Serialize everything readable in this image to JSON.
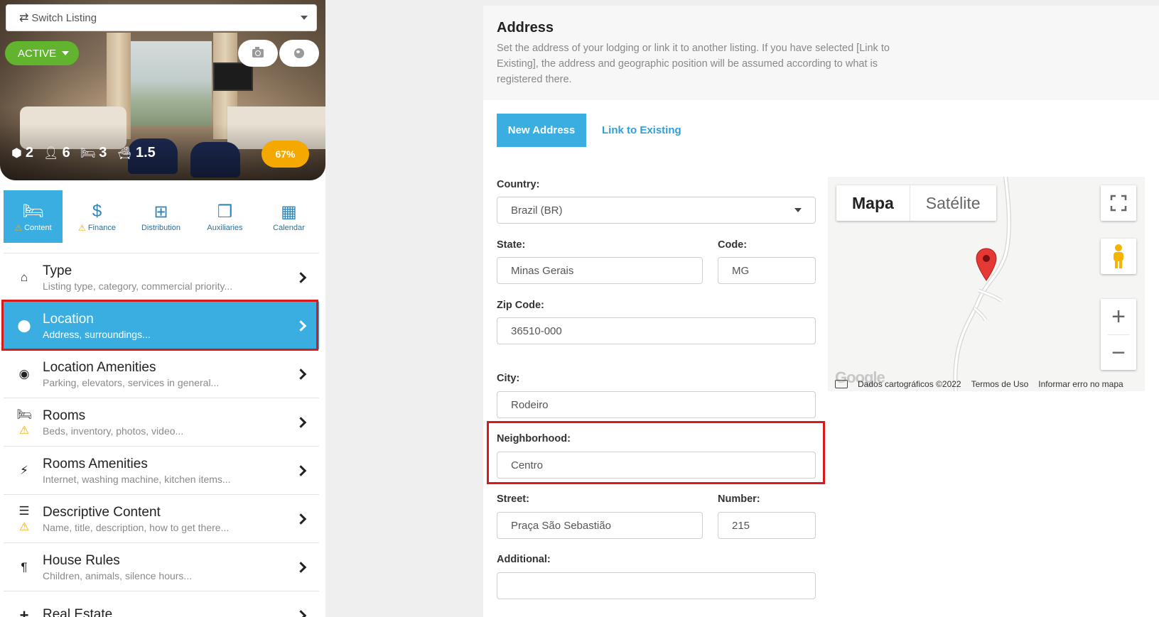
{
  "listing": {
    "switch_label": "Switch Listing",
    "status": "ACTIVE",
    "stats": {
      "units": "2",
      "guests": "6",
      "beds": "3",
      "baths": "1.5"
    },
    "completion": "67%"
  },
  "tabs": [
    {
      "label": "Content",
      "icon": "bed-icon",
      "warn": true,
      "active": true
    },
    {
      "label": "Finance",
      "icon": "dollar-icon",
      "warn": true,
      "active": false
    },
    {
      "label": "Distribution",
      "icon": "sitemap-icon",
      "warn": false,
      "active": false
    },
    {
      "label": "Auxiliaries",
      "icon": "cubes-icon",
      "warn": false,
      "active": false
    },
    {
      "label": "Calendar",
      "icon": "calendar-icon",
      "warn": false,
      "active": false
    }
  ],
  "menu": [
    {
      "title": "Type",
      "subtitle": "Listing type, category, commercial priority...",
      "icon": "home-icon",
      "warn": false
    },
    {
      "title": "Location",
      "subtitle": "Address, surroundings...",
      "icon": "map-pin-icon",
      "warn": false,
      "active": true
    },
    {
      "title": "Location Amenities",
      "subtitle": "Parking, elevators, services in general...",
      "icon": "target-icon",
      "warn": false
    },
    {
      "title": "Rooms",
      "subtitle": "Beds, inventory, photos, video...",
      "icon": "bed-icon",
      "warn": true
    },
    {
      "title": "Rooms Amenities",
      "subtitle": "Internet, washing machine, kitchen items...",
      "icon": "plug-icon",
      "warn": false
    },
    {
      "title": "Descriptive Content",
      "subtitle": "Name, title, description, how to get there...",
      "icon": "align-left-icon",
      "warn": true
    },
    {
      "title": "House Rules",
      "subtitle": "Children, animals, silence hours...",
      "icon": "paragraph-icon",
      "warn": false
    },
    {
      "title": "Real Estate",
      "subtitle": "",
      "icon": "plus-icon",
      "warn": false
    }
  ],
  "address": {
    "title": "Address",
    "description": "Set the address of your lodging or link it to another listing. If you have selected [Link to Existing], the address and geographic position will be assumed according to what is registered there.",
    "new_address_label": "New Address",
    "link_existing_label": "Link to Existing",
    "fields": {
      "country": {
        "label": "Country:",
        "value": "Brazil (BR)"
      },
      "state": {
        "label": "State:",
        "value": "Minas Gerais"
      },
      "code": {
        "label": "Code:",
        "value": "MG"
      },
      "zip": {
        "label": "Zip Code:",
        "value": "36510-000"
      },
      "city": {
        "label": "City:",
        "value": "Rodeiro"
      },
      "neighborhood": {
        "label": "Neighborhood:",
        "value": "Centro"
      },
      "street": {
        "label": "Street:",
        "value": "Praça São Sebastião"
      },
      "number": {
        "label": "Number:",
        "value": "215"
      },
      "additional": {
        "label": "Additional:",
        "value": ""
      }
    }
  },
  "map": {
    "type_map": "Mapa",
    "type_satellite": "Satélite",
    "logo": "Google",
    "data_credit": "Dados cartográficos ©2022",
    "terms": "Termos de Uso",
    "report": "Informar erro no mapa",
    "pin_color": "#e53935"
  },
  "colors": {
    "accent": "#3aaee0",
    "active_green": "#62b32d",
    "completion": "#f5a800",
    "highlight": "#d81a1a",
    "warning": "#f2a900"
  }
}
